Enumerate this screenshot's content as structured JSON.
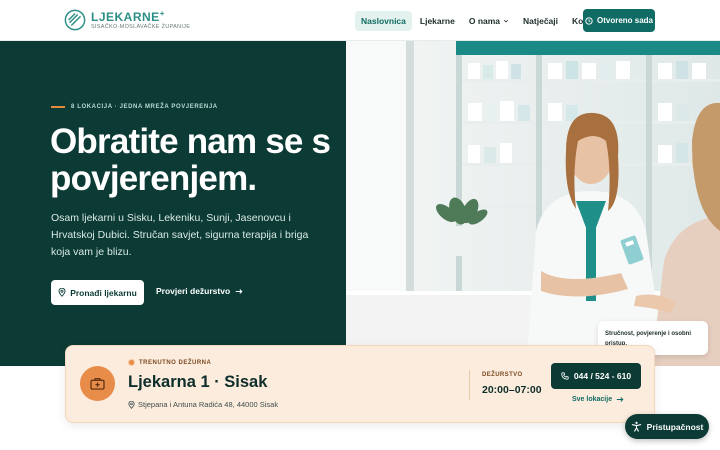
{
  "header": {
    "logo_name": "LJEKARNE",
    "logo_plus": "+",
    "logo_sub": "SISAČKO-MOSLAVAČKE ŽUPANIJE",
    "nav": [
      {
        "label": "Naslovnica",
        "active": true
      },
      {
        "label": "Ljekarne"
      },
      {
        "label": "O nama"
      },
      {
        "label": "Natječaji"
      },
      {
        "label": "Kontakt"
      }
    ],
    "cta_label": "Otvoreno sada"
  },
  "hero": {
    "eyebrow": "8 LOKACIJA · JEDNA MREŽA POVJERENJA",
    "title": "Obratite nam se s povjerenjem.",
    "description": "Osam ljekarni u Sisku, Lekeniku, Sunji, Jasenovcu i Hrvatskoj Dubici. Stručan savjet, sigurna terapija i briga koja vam je blizu.",
    "primary_button": "Pronađi ljekarnu",
    "secondary_link": "Provjeri dežurstvo",
    "photo_badge": "Stručnost, povjerenje i osobni pristup."
  },
  "duty": {
    "tag": "TRENUTNO DEŽURNA",
    "name": "Ljekarna 1 · Sisak",
    "address": "Stjepana i Antuna Radića 48, 44000 Sisak",
    "label": "DEŽURSTVO",
    "hours": "20:00–07:00",
    "phone": "044 / 524 - 610",
    "all_locations": "Sve lokacije"
  },
  "accessibility_label": "Pristupačnost",
  "colors": {
    "brand_dark": "#0c3b35",
    "brand_teal": "#0f6b63",
    "accent_orange": "#e88c4a",
    "duty_bg": "#fcecdd"
  }
}
